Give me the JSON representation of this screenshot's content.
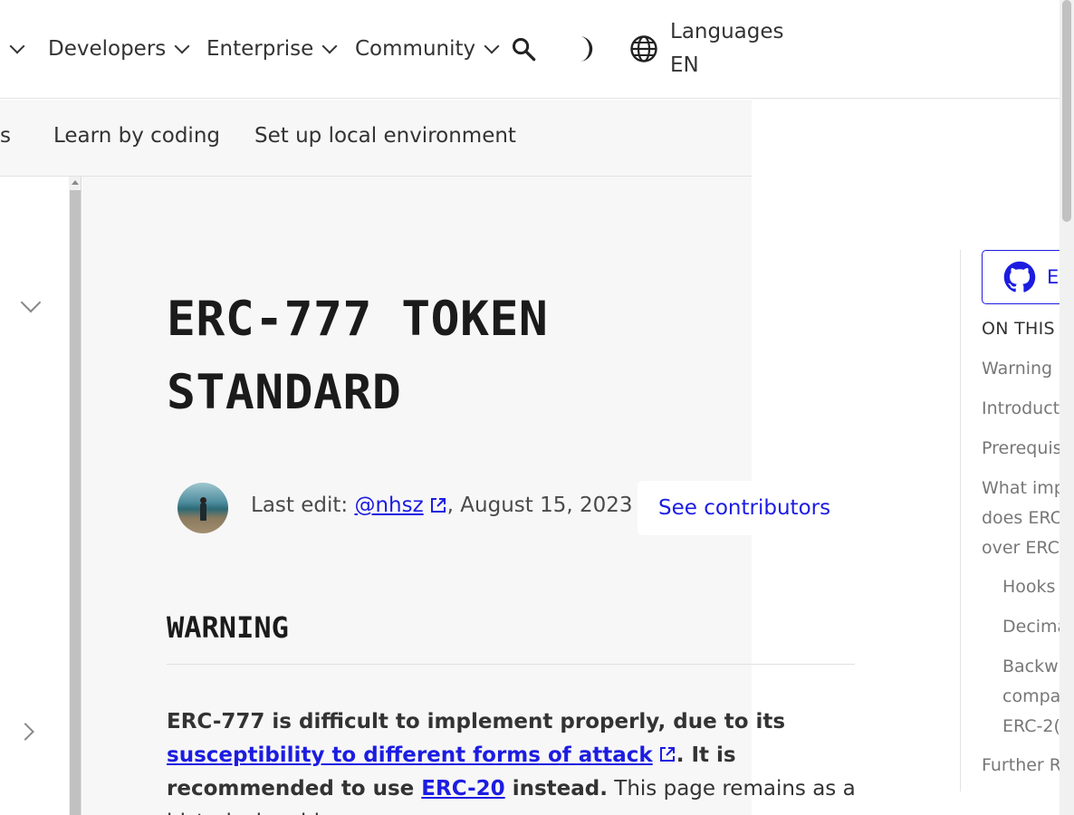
{
  "topnav": {
    "items": [
      {
        "label": "Developers"
      },
      {
        "label": "Enterprise"
      },
      {
        "label": "Community"
      }
    ],
    "search_icon": "search-icon",
    "theme_icon": "moon-icon",
    "language": {
      "label": "Languages",
      "code": "EN",
      "icon": "globe-icon"
    }
  },
  "subnav": {
    "items": [
      {
        "label": "s"
      },
      {
        "label": "Learn by coding"
      },
      {
        "label": "Set up local environment"
      }
    ]
  },
  "main": {
    "title": "ERC-777 TOKEN STANDARD",
    "last_edit": {
      "prefix": "Last edit: ",
      "user": "@nhsz",
      "date": ", August 15, 2023"
    },
    "see_contributors": "See contributors",
    "warning_heading": "WARNING",
    "warning": {
      "part1": "ERC-777 is difficult to implement properly, due to its ",
      "link1": "susceptibility to different forms of attack",
      "part2": ". It is recommended to use ",
      "link2": "ERC-20",
      "part3": " instead.",
      "part4": " This page remains as a historical archive."
    }
  },
  "toc": {
    "edit_label": "Ed",
    "heading": "ON THIS",
    "items": [
      {
        "label": "Warning"
      },
      {
        "label": "Introduct"
      },
      {
        "label": "Prerequis"
      },
      {
        "label": "What imp"
      },
      {
        "label": "does ERC"
      },
      {
        "label": "over ERC"
      },
      {
        "label": "Hooks"
      },
      {
        "label": "Decima"
      },
      {
        "label": "Backw"
      },
      {
        "label": "compa"
      },
      {
        "label": "ERC-2("
      },
      {
        "label": "Further R"
      }
    ]
  },
  "colors": {
    "link": "#1c1ce1",
    "background_main": "#f7f7f7",
    "text": "#333333"
  }
}
